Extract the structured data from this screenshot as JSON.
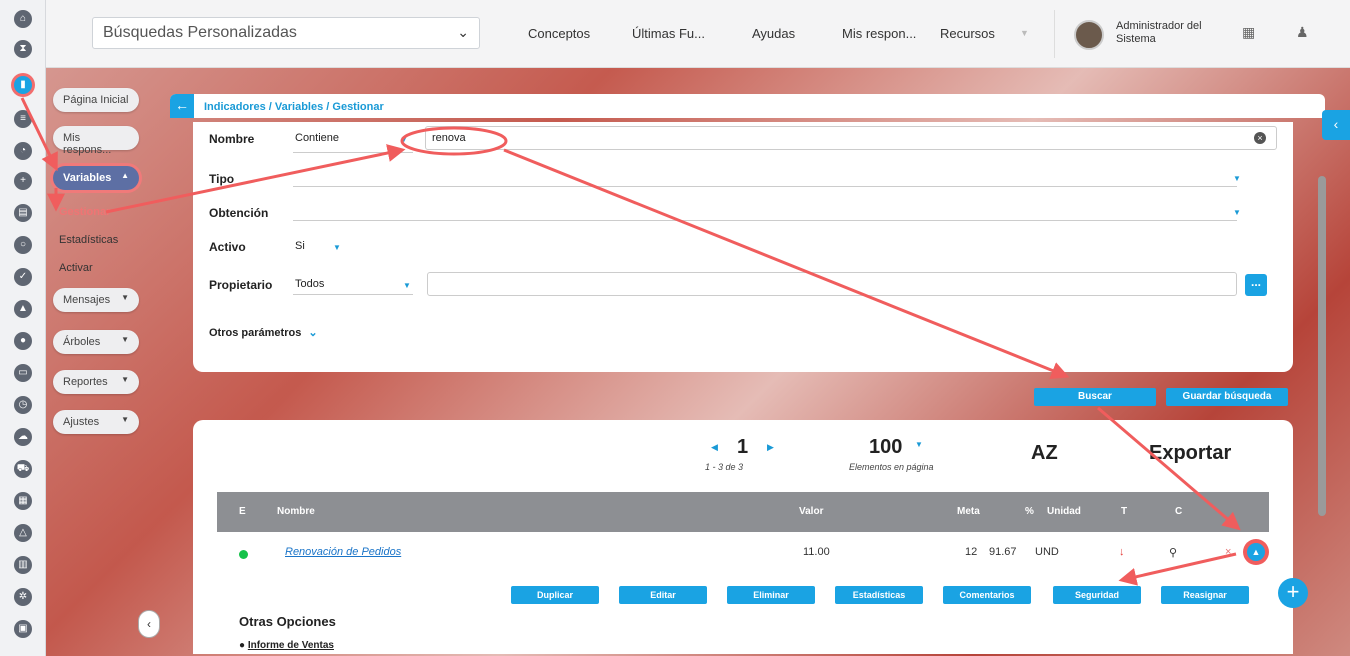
{
  "topbar": {
    "search_value": "Búsquedas Personalizadas",
    "nav": [
      "Conceptos",
      "Últimas Fu...",
      "Ayudas",
      "Mis respon...",
      "Recursos"
    ],
    "user_line1": "Administrador del",
    "user_line2": "Sistema"
  },
  "menu": {
    "home": "Página Inicial",
    "mis": "Mis respons...",
    "variables": "Variables",
    "gestionar": "Gestionar",
    "estadisticas": "Estadísticas",
    "activar": "Activar",
    "mensajes": "Mensajes",
    "arboles": "Árboles",
    "reportes": "Reportes",
    "ajustes": "Ajustes"
  },
  "breadcrumb": "Indicadores / Variables / Gestionar",
  "filters": {
    "nombre_label": "Nombre",
    "nombre_op": "Contiene",
    "nombre_value": "renova",
    "tipo_label": "Tipo",
    "obtencion_label": "Obtención",
    "activo_label": "Activo",
    "activo_value": "Si",
    "propietario_label": "Propietario",
    "propietario_value": "Todos",
    "more_params": "Otros parámetros",
    "more_btn": "..."
  },
  "actions": {
    "search": "Buscar",
    "save": "Guardar búsqueda"
  },
  "pager": {
    "page": "1",
    "range": "1 - 3 de 3",
    "per_page": "100",
    "per_page_label": "Elementos en página",
    "sort": "AZ",
    "export": "Exportar"
  },
  "table": {
    "headers": [
      "E",
      "Nombre",
      "Valor",
      "Meta",
      "%",
      "Unidad",
      "T",
      "C"
    ],
    "row": {
      "name": "Renovación de Pedidos",
      "value": "11.00",
      "goal": "12",
      "percent": "91.67",
      "unit": "UND"
    },
    "row_actions": [
      "Duplicar",
      "Editar",
      "Eliminar",
      "Estadísticas",
      "Comentarios",
      "Seguridad",
      "Reasignar"
    ],
    "other_options_title": "Otras Opciones",
    "other_option_1": "Informe de Ventas"
  },
  "colors": {
    "accent": "#1aa3e3",
    "annotation": "#f05d5d",
    "status_ok": "#16c24a"
  }
}
